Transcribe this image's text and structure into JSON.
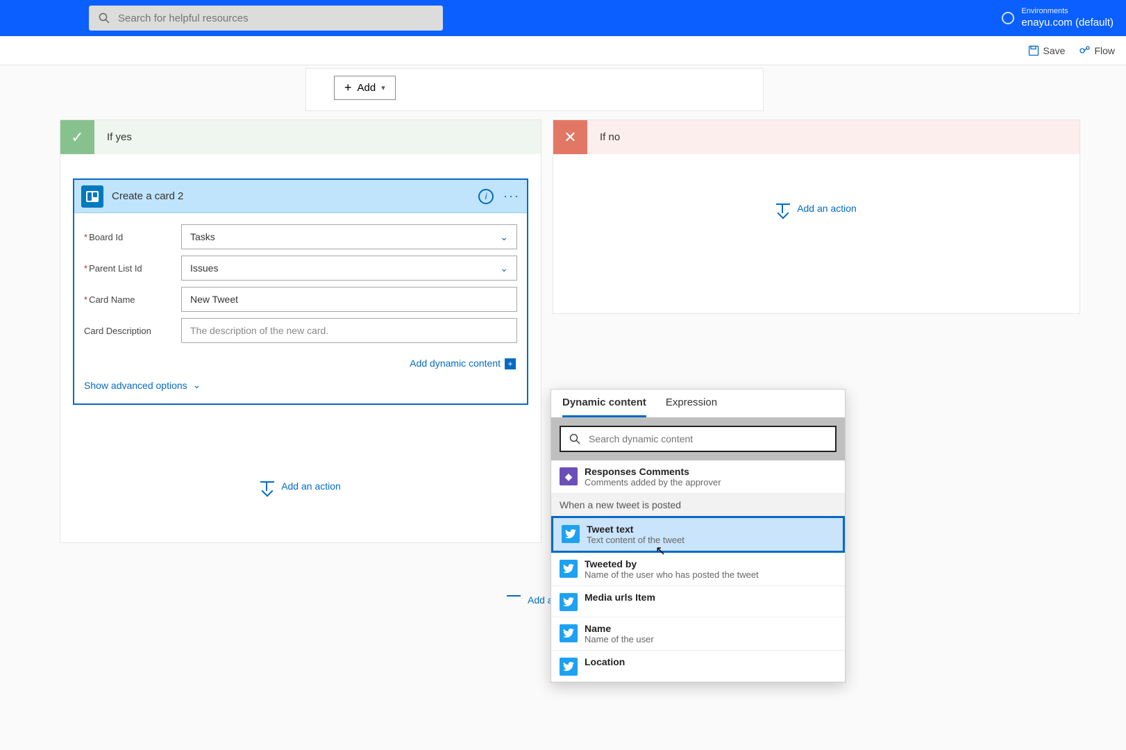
{
  "header": {
    "search_placeholder": "Search for helpful resources",
    "env_label": "Environments",
    "env_value": "enayu.com (default)"
  },
  "commandbar": {
    "save": "Save",
    "flow": "Flow"
  },
  "condition": {
    "add_btn": "Add"
  },
  "branch_yes": {
    "title": "If yes"
  },
  "branch_no": {
    "title": "If no"
  },
  "card": {
    "title": "Create a card 2",
    "fields": {
      "board_id": {
        "label": "Board Id",
        "value": "Tasks",
        "required": true,
        "dropdown": true
      },
      "parent_list": {
        "label": "Parent List Id",
        "value": "Issues",
        "required": true,
        "dropdown": true
      },
      "card_name": {
        "label": "Card Name",
        "value": "New Tweet",
        "required": true,
        "dropdown": false
      },
      "card_desc": {
        "label": "Card Description",
        "placeholder": "The description of the new card.",
        "required": false
      }
    },
    "add_dynamic": "Add dynamic content",
    "advanced": "Show advanced options"
  },
  "add_action": "Add an action",
  "center_add": "Add an a",
  "popover": {
    "tabs": {
      "dynamic": "Dynamic content",
      "expression": "Expression"
    },
    "search_placeholder": "Search dynamic content",
    "group_responses": {
      "title": "Responses Comments",
      "desc": "Comments added by the approver"
    },
    "group_tweet_header": "When a new tweet is posted",
    "items": [
      {
        "title": "Tweet text",
        "desc": "Text content of the tweet",
        "selected": true
      },
      {
        "title": "Tweeted by",
        "desc": "Name of the user who has posted the tweet"
      },
      {
        "title": "Media urls Item",
        "desc": ""
      },
      {
        "title": "Name",
        "desc": "Name of the user"
      },
      {
        "title": "Location",
        "desc": ""
      }
    ]
  }
}
